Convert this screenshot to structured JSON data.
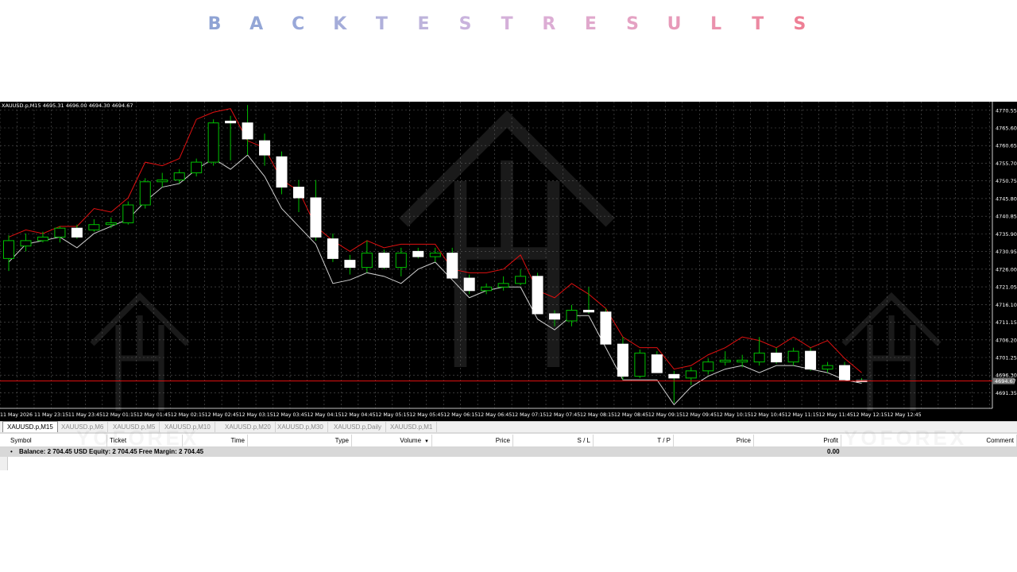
{
  "title_letters": [
    {
      "char": "B",
      "color": "#8fa3d4"
    },
    {
      "char": "A",
      "color": "#93a6d6"
    },
    {
      "char": "C",
      "color": "#99a8d9"
    },
    {
      "char": "K",
      "color": "#a4acd9"
    },
    {
      "char": "T",
      "color": "#b0b0db"
    },
    {
      "char": "E",
      "color": "#bdb3db"
    },
    {
      "char": "S",
      "color": "#c9b3dd"
    },
    {
      "char": "T",
      "color": "#d4b0d9"
    },
    {
      "char": "R",
      "color": "#dcadd4"
    },
    {
      "char": "E",
      "color": "#e0a8cc"
    },
    {
      "char": "S",
      "color": "#e4a2c3"
    },
    {
      "char": "U",
      "color": "#e79ab9"
    },
    {
      "char": "L",
      "color": "#ea91ad"
    },
    {
      "char": "T",
      "color": "#ec89a2"
    },
    {
      "char": "S",
      "color": "#ee7f95"
    }
  ],
  "symbol_info": "XAUUSD.p,M15  4695.31 4696.00 4694.30 4694.67",
  "colors": {
    "background": "#000000",
    "grid": "#5a5a5a",
    "bull_candle": "#000000",
    "bull_outline": "#00c000",
    "bear_candle": "#ffffff",
    "upper_band": "#e01010",
    "lower_band": "#cfcfcf",
    "bid_line": "#e01010",
    "price_label_bg": "#777777"
  },
  "chart_data": {
    "type": "candlestick",
    "ylim": [
      4687.0,
      4772.5
    ],
    "y_ticks": [
      "4770.55",
      "4765.60",
      "4760.65",
      "4755.70",
      "4750.75",
      "4745.80",
      "4740.85",
      "4735.90",
      "4730.95",
      "4726.00",
      "4721.05",
      "4716.10",
      "4711.15",
      "4706.20",
      "4701.25",
      "4696.30",
      "4691.35"
    ],
    "current_price": "4694.67",
    "x_labels": [
      "11 May 2026",
      "11 May 23:15",
      "11 May 23:45",
      "12 May 01:15",
      "12 May 01:45",
      "12 May 02:15",
      "12 May 02:45",
      "12 May 03:15",
      "12 May 03:45",
      "12 May 04:15",
      "12 May 04:45",
      "12 May 05:15",
      "12 May 05:45",
      "12 May 06:15",
      "12 May 06:45",
      "12 May 07:15",
      "12 May 07:45",
      "12 May 08:15",
      "12 May 08:45",
      "12 May 09:15",
      "12 May 09:45",
      "12 May 10:15",
      "12 May 10:45",
      "12 May 11:15",
      "12 May 11:45",
      "12 May 12:15",
      "12 May 12:45"
    ],
    "candles": [
      {
        "o": 4729.0,
        "h": 4735.5,
        "l": 4725.5,
        "c": 4734.0
      },
      {
        "o": 4732.5,
        "h": 4736.0,
        "l": 4731.0,
        "c": 4734.0
      },
      {
        "o": 4734.0,
        "h": 4736.5,
        "l": 4733.5,
        "c": 4735.0
      },
      {
        "o": 4735.0,
        "h": 4738.0,
        "l": 4733.5,
        "c": 4737.5
      },
      {
        "o": 4737.5,
        "h": 4738.5,
        "l": 4734.5,
        "c": 4735.0
      },
      {
        "o": 4737.0,
        "h": 4740.0,
        "l": 4736.5,
        "c": 4738.5
      },
      {
        "o": 4738.5,
        "h": 4740.5,
        "l": 4737.5,
        "c": 4739.0
      },
      {
        "o": 4739.0,
        "h": 4745.0,
        "l": 4738.5,
        "c": 4744.0
      },
      {
        "o": 4744.0,
        "h": 4751.5,
        "l": 4743.0,
        "c": 4750.5
      },
      {
        "o": 4750.5,
        "h": 4753.0,
        "l": 4749.0,
        "c": 4751.0
      },
      {
        "o": 4751.0,
        "h": 4754.0,
        "l": 4750.0,
        "c": 4753.0
      },
      {
        "o": 4753.0,
        "h": 4757.0,
        "l": 4752.0,
        "c": 4756.0
      },
      {
        "o": 4756.0,
        "h": 4768.0,
        "l": 4755.0,
        "c": 4767.0
      },
      {
        "o": 4767.5,
        "h": 4769.0,
        "l": 4756.5,
        "c": 4767.0
      },
      {
        "o": 4767.0,
        "h": 4772.0,
        "l": 4758.0,
        "c": 4762.5
      },
      {
        "o": 4762.0,
        "h": 4764.0,
        "l": 4755.0,
        "c": 4758.0
      },
      {
        "o": 4757.5,
        "h": 4759.0,
        "l": 4747.0,
        "c": 4749.0
      },
      {
        "o": 4749.0,
        "h": 4751.0,
        "l": 4742.0,
        "c": 4746.0
      },
      {
        "o": 4746.0,
        "h": 4751.0,
        "l": 4734.0,
        "c": 4735.0
      },
      {
        "o": 4734.5,
        "h": 4736.0,
        "l": 4728.0,
        "c": 4729.0
      },
      {
        "o": 4728.5,
        "h": 4730.0,
        "l": 4724.5,
        "c": 4726.5
      },
      {
        "o": 4726.5,
        "h": 4734.0,
        "l": 4725.0,
        "c": 4730.5
      },
      {
        "o": 4730.5,
        "h": 4731.5,
        "l": 4726.0,
        "c": 4726.5
      },
      {
        "o": 4726.5,
        "h": 4732.0,
        "l": 4724.0,
        "c": 4730.5
      },
      {
        "o": 4731.0,
        "h": 4732.0,
        "l": 4729.0,
        "c": 4729.5
      },
      {
        "o": 4729.5,
        "h": 4732.0,
        "l": 4728.0,
        "c": 4730.5
      },
      {
        "o": 4730.5,
        "h": 4732.0,
        "l": 4723.5,
        "c": 4723.5
      },
      {
        "o": 4723.5,
        "h": 4724.5,
        "l": 4719.0,
        "c": 4720.0
      },
      {
        "o": 4720.0,
        "h": 4722.0,
        "l": 4719.0,
        "c": 4721.0
      },
      {
        "o": 4721.0,
        "h": 4724.0,
        "l": 4720.0,
        "c": 4722.0
      },
      {
        "o": 4722.0,
        "h": 4726.0,
        "l": 4721.5,
        "c": 4724.0
      },
      {
        "o": 4724.0,
        "h": 4725.0,
        "l": 4713.5,
        "c": 4713.5
      },
      {
        "o": 4713.5,
        "h": 4714.5,
        "l": 4710.0,
        "c": 4712.0
      },
      {
        "o": 4711.5,
        "h": 4716.0,
        "l": 4710.0,
        "c": 4714.5
      },
      {
        "o": 4714.5,
        "h": 4721.0,
        "l": 4713.5,
        "c": 4714.0
      },
      {
        "o": 4714.0,
        "h": 4715.0,
        "l": 4705.0,
        "c": 4705.0
      },
      {
        "o": 4705.0,
        "h": 4707.0,
        "l": 4695.0,
        "c": 4696.0
      },
      {
        "o": 4696.0,
        "h": 4703.5,
        "l": 4695.5,
        "c": 4702.5
      },
      {
        "o": 4702.0,
        "h": 4703.0,
        "l": 4697.0,
        "c": 4697.0
      },
      {
        "o": 4696.5,
        "h": 4697.5,
        "l": 4688.5,
        "c": 4695.5
      },
      {
        "o": 4695.5,
        "h": 4698.5,
        "l": 4693.5,
        "c": 4697.5
      },
      {
        "o": 4697.5,
        "h": 4701.0,
        "l": 4696.5,
        "c": 4700.0
      },
      {
        "o": 4700.0,
        "h": 4703.0,
        "l": 4699.0,
        "c": 4700.5
      },
      {
        "o": 4700.0,
        "h": 4702.0,
        "l": 4698.5,
        "c": 4700.5
      },
      {
        "o": 4700.0,
        "h": 4707.0,
        "l": 4699.0,
        "c": 4702.5
      },
      {
        "o": 4702.5,
        "h": 4704.0,
        "l": 4699.5,
        "c": 4700.0
      },
      {
        "o": 4700.0,
        "h": 4704.0,
        "l": 4699.0,
        "c": 4703.0
      },
      {
        "o": 4703.0,
        "h": 4704.0,
        "l": 4697.5,
        "c": 4698.0
      },
      {
        "o": 4698.0,
        "h": 4700.0,
        "l": 4697.0,
        "c": 4699.0
      },
      {
        "o": 4699.0,
        "h": 4700.0,
        "l": 4695.0,
        "c": 4695.0
      },
      {
        "o": 4694.8,
        "h": 4695.5,
        "l": 4694.3,
        "c": 4694.7
      }
    ],
    "upper_band": [
      4735,
      4737,
      4736,
      4738,
      4738,
      4743,
      4742,
      4746,
      4756,
      4755,
      4757,
      4768,
      4770,
      4771,
      4762,
      4760,
      4751,
      4748,
      4738,
      4734,
      4731,
      4734,
      4732,
      4733,
      4733,
      4733,
      4726,
      4725,
      4725,
      4726,
      4730,
      4720,
      4718,
      4722,
      4719,
      4715,
      4707,
      4704,
      4704,
      4698,
      4699,
      4702,
      4704,
      4707,
      4706,
      4704,
      4707,
      4704,
      4706,
      4701,
      4697
    ],
    "lower_band": [
      4728,
      4733,
      4734,
      4735,
      4732,
      4736,
      4738,
      4740,
      4745,
      4749,
      4750,
      4754,
      4757,
      4754,
      4758,
      4752,
      4743,
      4738,
      4733,
      4722,
      4723,
      4725,
      4724,
      4722,
      4726,
      4728,
      4723,
      4718,
      4720,
      4721,
      4721,
      4712,
      4709,
      4713,
      4713,
      4704,
      4695,
      4695,
      4695,
      4688,
      4693,
      4696,
      4698,
      4699,
      4697,
      4699,
      4699,
      4698,
      4697,
      4695,
      4694
    ]
  },
  "tabs": [
    "XAUUSD.p,M15",
    "XAUUSD.p,M6",
    "XAUUSD.p,M5",
    "XAUUSD.p,M10",
    "XAUUSD.p,M20",
    "XAUUSD.p,M30",
    "XAUUSD.p,Daily",
    "XAUUSD.p,M1"
  ],
  "watermark_text": "YOFOREX",
  "table": {
    "close_symbol": "×",
    "columns": [
      "Symbol",
      "Ticket",
      "Time",
      "Type",
      "Volume",
      "Price",
      "S / L",
      "T / P",
      "Price",
      "Profit",
      "Comment"
    ],
    "sort_indicator": "▼",
    "balance_bullet": "•",
    "balance_text": "Balance: 2 704.45 USD  Equity: 2 704.45  Free Margin: 2 704.45",
    "profit_value": "0.00"
  }
}
